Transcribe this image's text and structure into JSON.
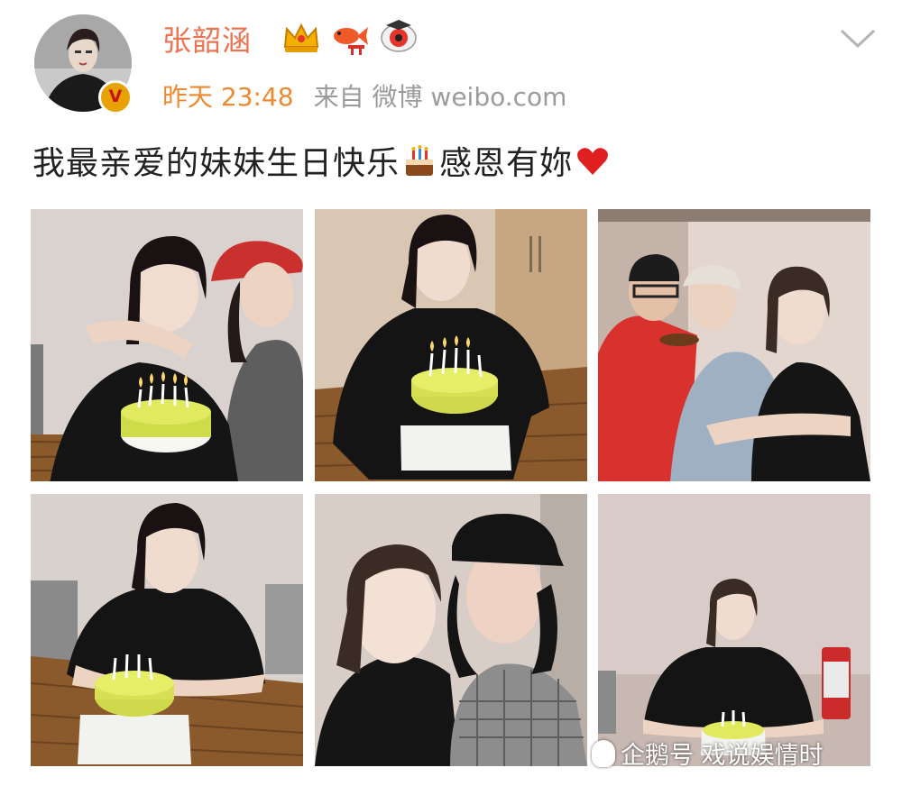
{
  "post": {
    "author": "张韶涵",
    "time": "昨天 23:48",
    "source_prefix": "来自",
    "source": "微博 weibo.com",
    "text": "我最亲爱的妹妹生日快乐",
    "text_after_cake": "感恩有妳",
    "verified_mark": "V"
  },
  "photos": [
    {
      "name": "photo-1"
    },
    {
      "name": "photo-2"
    },
    {
      "name": "photo-3"
    },
    {
      "name": "photo-4"
    },
    {
      "name": "photo-5"
    },
    {
      "name": "photo-6"
    }
  ],
  "watermark": {
    "text": "企鹅号 戏说娱情时"
  },
  "icons": {
    "verified": "verified-badge-icon",
    "crown": "crown-icon",
    "koi": "koi-fish-icon",
    "eye": "weibo-eye-icon",
    "cake": "cake-emoji-icon",
    "heart": "heart-emoji-icon",
    "expand": "chevron-down-icon"
  },
  "colors": {
    "name": "#eb7350",
    "time": "#eb8a30",
    "meta": "#9b9b9b",
    "text": "#222222"
  }
}
